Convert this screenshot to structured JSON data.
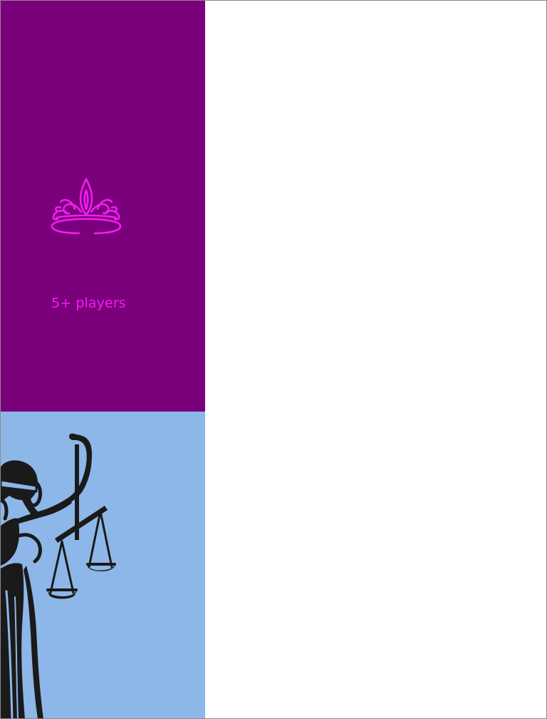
{
  "card": {
    "top_color": "#7b007b",
    "accent_color": "#f21df2",
    "bottom_color": "#8db7e8",
    "icon": "crown-icon",
    "players_label": "5+ players",
    "illustration": "lady-justice-illustration"
  }
}
